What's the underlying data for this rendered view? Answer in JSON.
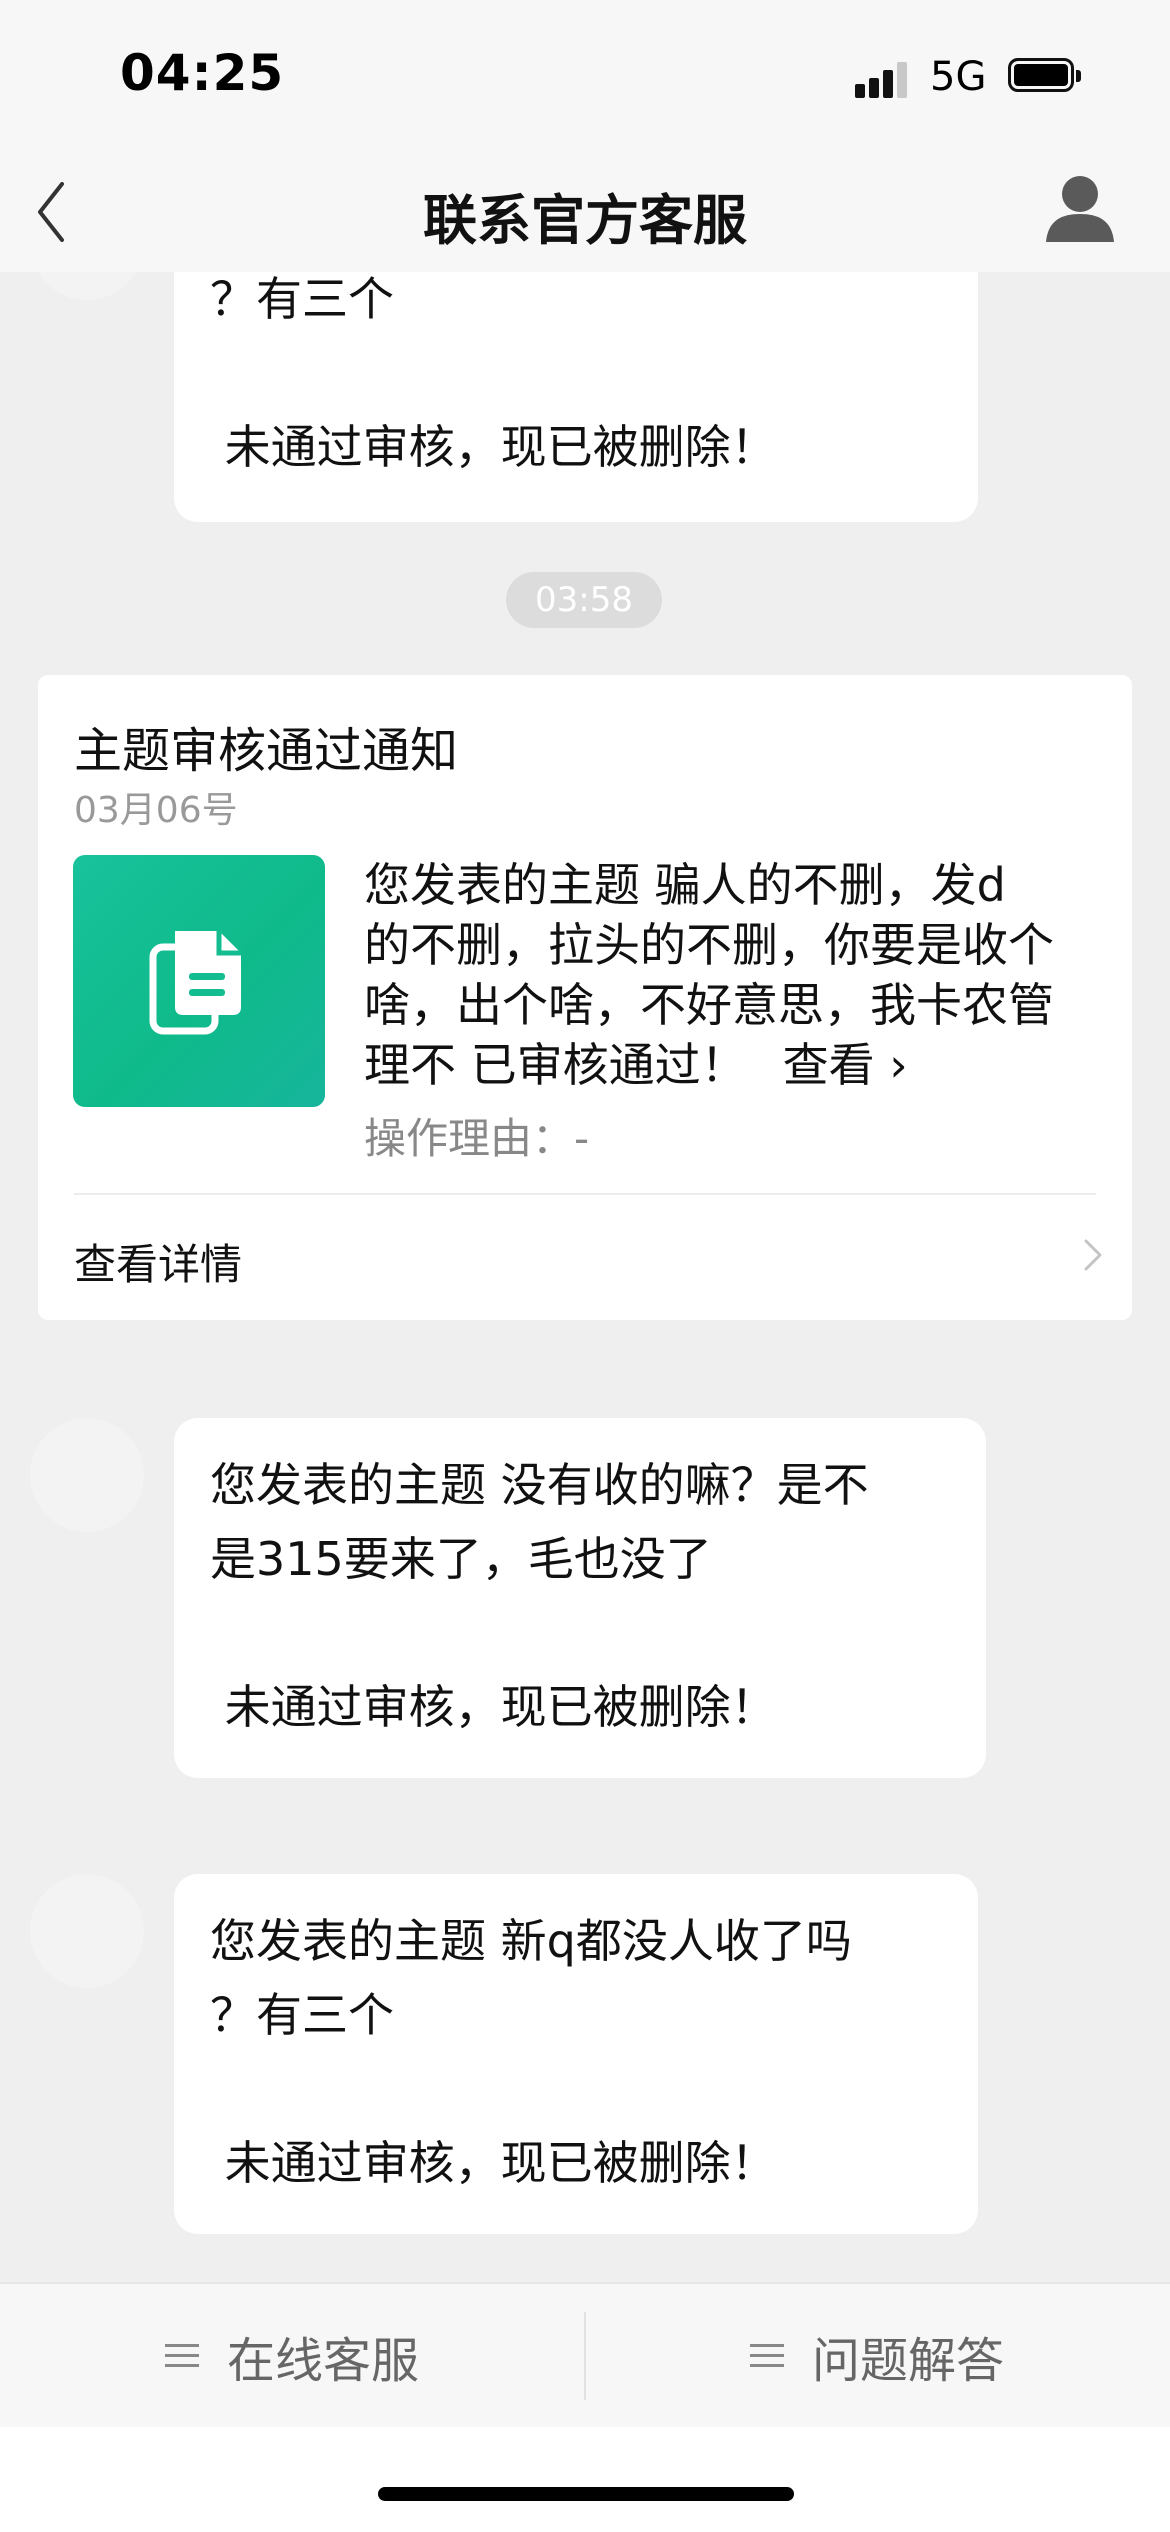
{
  "status_bar": {
    "time": "04:25",
    "network": "5G"
  },
  "nav": {
    "title": "联系官方客服",
    "back_icon": "chevron-left-icon",
    "profile_icon": "user-icon"
  },
  "messages": [
    {
      "lines": [
        "？有三个",
        "",
        " 未通过审核，现已被删除！"
      ]
    },
    {
      "lines": [
        "您发表的主题 没有收的嘛？是不",
        "是315要来了，毛也没了",
        "",
        " 未通过审核，现已被删除！"
      ]
    },
    {
      "lines": [
        "您发表的主题 新q都没人收了吗",
        "？有三个",
        "",
        " 未通过审核，现已被删除！"
      ]
    }
  ],
  "timestamp": "03:58",
  "card": {
    "title": "主题审核通过通知",
    "date": "03月06号",
    "body_lines": [
      "您发表的主题 骗人的不删，发d",
      "的不删，拉头的不删，你要是收个",
      "啥，出个啥，不好意思，我卡农管",
      "理不 已审核通过！"
    ],
    "view_link": "查看 ›",
    "reason": "操作理由：-",
    "detail_label": "查看详情",
    "thumb_icon": "document-icon"
  },
  "tabs": [
    {
      "label": "在线客服",
      "icon": "menu-icon"
    },
    {
      "label": "问题解答",
      "icon": "menu-icon"
    }
  ],
  "colors": {
    "background": "#efefef",
    "bubble": "#ffffff",
    "thumb_green": "#12bf92",
    "timestamp_pill": "#dcdcdc"
  }
}
